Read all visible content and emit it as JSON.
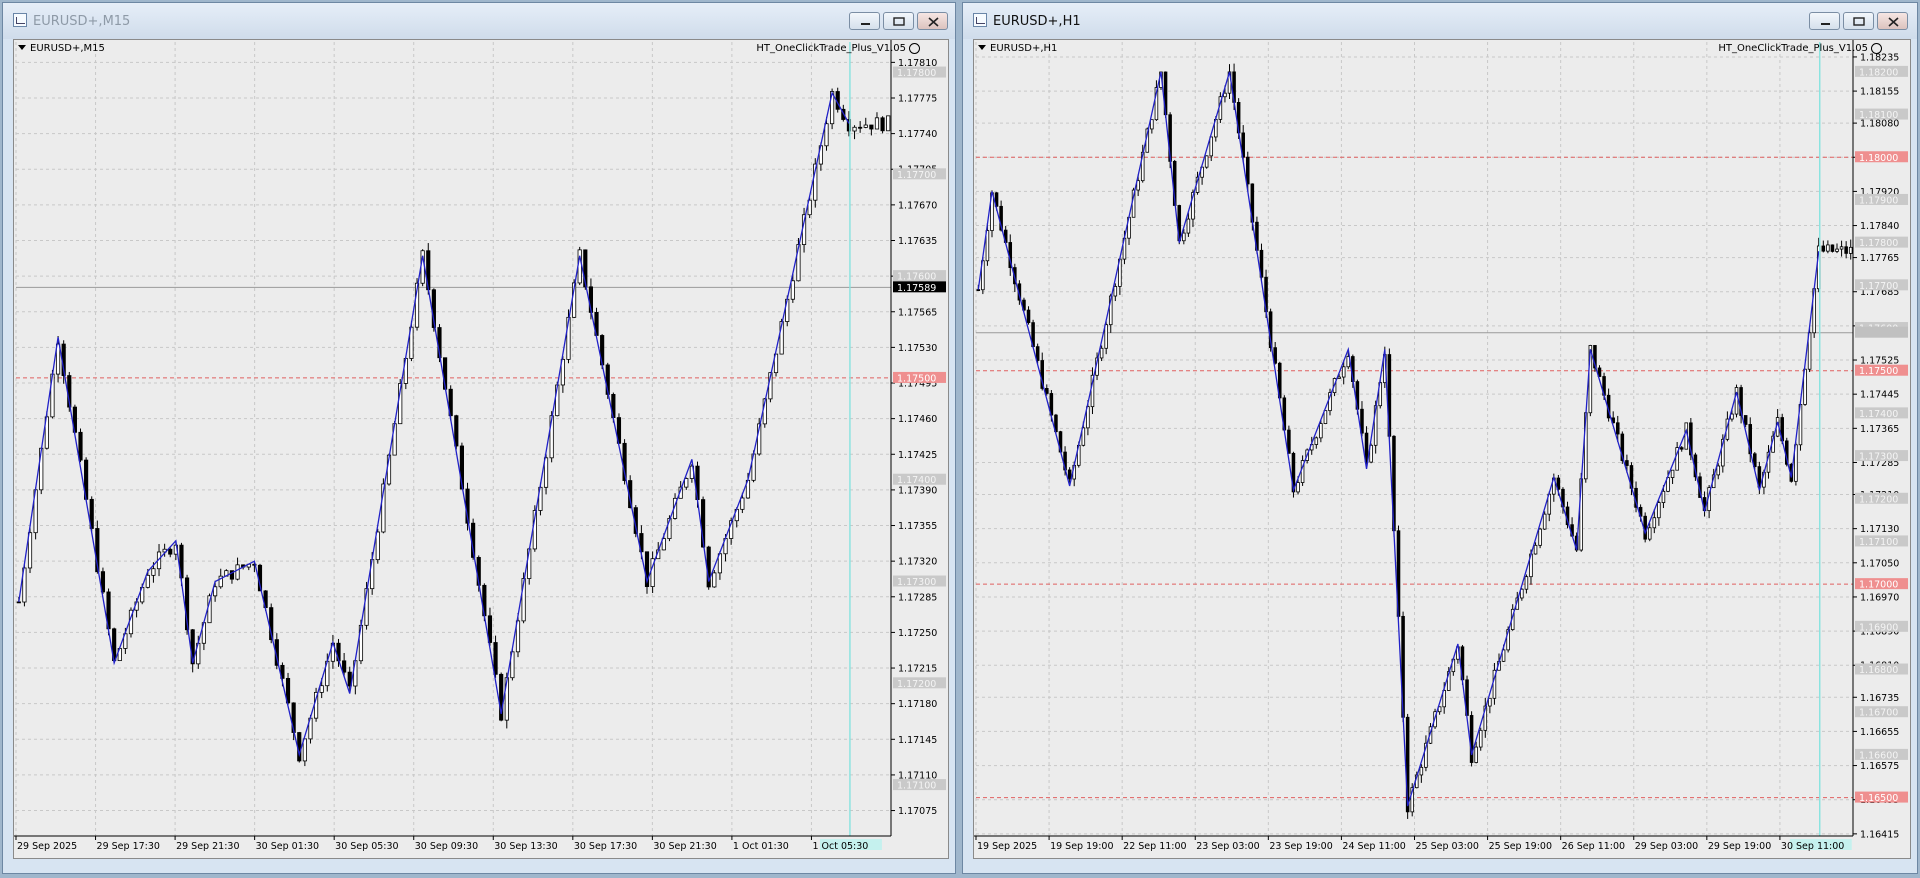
{
  "windows": [
    {
      "id": "left",
      "title": "EURUSD+,M15",
      "symbol_label": "EURUSD+,M15",
      "ea_label": "HT_OneClickTrade_Plus_V1.05",
      "y_max": 1.1783,
      "y_min": 1.1705,
      "price_ticks": [
        "1.17810",
        "1.17775",
        "1.17740",
        "1.17705",
        "1.17670",
        "1.17635",
        "1.17600",
        "1.17565",
        "1.17530",
        "1.17495",
        "1.17460",
        "1.17425",
        "1.17390",
        "1.17355",
        "1.17320",
        "1.17285",
        "1.17250",
        "1.17215",
        "1.17180",
        "1.17145",
        "1.17110",
        "1.17075"
      ],
      "grey_levels": [
        1.178,
        1.177,
        1.176,
        1.174,
        1.173,
        1.172,
        1.171
      ],
      "red_levels": [
        1.175
      ],
      "current_price": 1.17589,
      "current_price_label": "1.17589",
      "time_labels": [
        "29 Sep 2025",
        "29 Sep 17:30",
        "29 Sep 21:30",
        "30 Sep 01:30",
        "30 Sep 05:30",
        "30 Sep 09:30",
        "30 Sep 13:30",
        "30 Sep 17:30",
        "30 Sep 21:30",
        "1 Oct 01:30",
        "1 Oct 05:30"
      ],
      "zigzag": [
        [
          0,
          1.1728
        ],
        [
          7,
          1.1754
        ],
        [
          17,
          1.1722
        ],
        [
          23,
          1.1731
        ],
        [
          28,
          1.1734
        ],
        [
          31,
          1.1722
        ],
        [
          35,
          1.173
        ],
        [
          42,
          1.1732
        ],
        [
          50,
          1.1713
        ],
        [
          56,
          1.1724
        ],
        [
          59,
          1.1719
        ],
        [
          72,
          1.1762
        ],
        [
          86,
          1.1717
        ],
        [
          100,
          1.1762
        ],
        [
          112,
          1.173
        ],
        [
          120,
          1.1742
        ],
        [
          123,
          1.173
        ],
        [
          130,
          1.174
        ],
        [
          145,
          1.1778
        ],
        [
          148,
          1.1775
        ]
      ],
      "colors": {
        "candle": "#000000",
        "zigzag": "#2121c8",
        "grid": "#c8c8c8",
        "red_level": "#e06060",
        "vline": "#86e3df"
      }
    },
    {
      "id": "right",
      "title": "EURUSD+,H1",
      "symbol_label": "EURUSD+,H1",
      "ea_label": "HT_OneClickTrade_Plus_V1.05",
      "y_max": 1.1827,
      "y_min": 1.1641,
      "price_ticks": [
        "1.18235",
        "1.18155",
        "1.18080",
        "1.18000",
        "1.17920",
        "1.17840",
        "1.17765",
        "1.17685",
        "1.17605",
        "1.17525",
        "1.17445",
        "1.17365",
        "1.17285",
        "1.17210",
        "1.17130",
        "1.17050",
        "1.16970",
        "1.16890",
        "1.16810",
        "1.16735",
        "1.16655",
        "1.16575",
        "1.16495",
        "1.16415"
      ],
      "grey_levels": [
        1.182,
        1.181,
        1.179,
        1.178,
        1.177,
        1.176,
        1.174,
        1.173,
        1.172,
        1.171,
        1.169,
        1.168,
        1.167,
        1.166
      ],
      "red_levels": [
        1.18,
        1.175,
        1.17,
        1.165
      ],
      "current_price": 1.17589,
      "current_price_label": "",
      "time_labels": [
        "19 Sep 2025",
        "19 Sep 19:00",
        "22 Sep 11:00",
        "23 Sep 03:00",
        "23 Sep 19:00",
        "24 Sep 11:00",
        "25 Sep 03:00",
        "25 Sep 19:00",
        "26 Sep 11:00",
        "29 Sep 03:00",
        "29 Sep 19:00",
        "30 Sep 11:00"
      ],
      "zigzag": [
        [
          0,
          1.1769
        ],
        [
          3,
          1.1792
        ],
        [
          20,
          1.1723
        ],
        [
          40,
          1.182
        ],
        [
          44,
          1.178
        ],
        [
          55,
          1.182
        ],
        [
          69,
          1.1722
        ],
        [
          81,
          1.1755
        ],
        [
          85,
          1.1727
        ],
        [
          89,
          1.1755
        ],
        [
          94,
          1.1648
        ],
        [
          105,
          1.1686
        ],
        [
          108,
          1.166
        ],
        [
          126,
          1.1725
        ],
        [
          131,
          1.1708
        ],
        [
          134,
          1.1755
        ],
        [
          146,
          1.1712
        ],
        [
          155,
          1.1736
        ],
        [
          159,
          1.1717
        ],
        [
          166,
          1.1745
        ],
        [
          171,
          1.1722
        ],
        [
          175,
          1.1738
        ],
        [
          178,
          1.1725
        ],
        [
          184,
          1.1778
        ]
      ],
      "colors": {
        "candle": "#000000",
        "zigzag": "#2121c8",
        "grid": "#c8c8c8",
        "red_level": "#e06060",
        "vline": "#86e3df"
      }
    }
  ]
}
